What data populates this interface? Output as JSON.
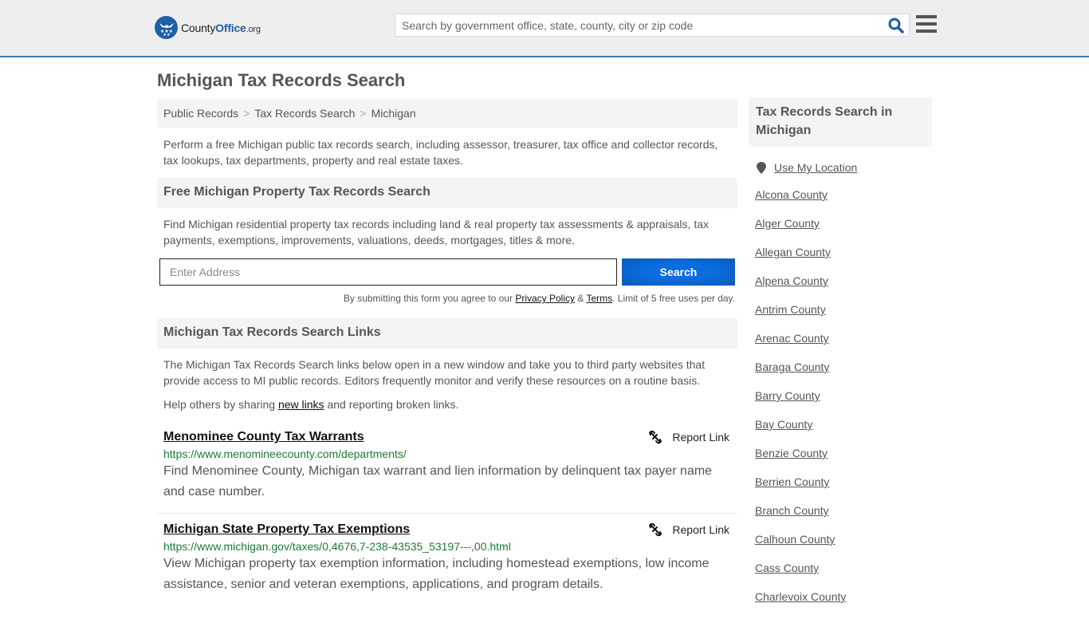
{
  "header": {
    "logo": {
      "name_part1": "County",
      "name_part2": "Office",
      "tld": ".org"
    },
    "search": {
      "placeholder": "Search by government office, state, county, city or zip code",
      "value": ""
    }
  },
  "page_title": "Michigan Tax Records Search",
  "breadcrumb": [
    {
      "label": "Public Records"
    },
    {
      "label": "Tax Records Search"
    },
    {
      "label": "Michigan"
    }
  ],
  "breadcrumb_separator": ">",
  "intro": "Perform a free Michigan public tax records search, including assessor, treasurer, tax office and collector records, tax lookups, tax departments, property and real estate taxes.",
  "property_search": {
    "heading": "Free Michigan Property Tax Records Search",
    "description": "Find Michigan residential property tax records including land & real property tax assessments & appraisals, tax payments, exemptions, improvements, valuations, deeds, mortgages, titles & more.",
    "input_placeholder": "Enter Address",
    "input_value": "",
    "button_label": "Search",
    "disclaimer_prefix": "By submitting this form you agree to our ",
    "privacy_label": "Privacy Policy",
    "amp": " & ",
    "terms_label": "Terms",
    "disclaimer_suffix": ". Limit of 5 free uses per day."
  },
  "links_section": {
    "heading": "Michigan Tax Records Search Links",
    "description": "The Michigan Tax Records Search links below open in a new window and take you to third party websites that provide access to MI public records. Editors frequently monitor and verify these resources on a routine basis.",
    "share_prefix": "Help others by sharing ",
    "share_link": "new links",
    "share_suffix": " and reporting broken links.",
    "report_label": "Report Link",
    "items": [
      {
        "title": "Menominee County Tax Warrants",
        "url": "https://www.menomineecounty.com/departments/",
        "description": "Find Menominee County, Michigan tax warrant and lien information by delinquent tax payer name and case number."
      },
      {
        "title": "Michigan State Property Tax Exemptions",
        "url": "https://www.michigan.gov/taxes/0,4676,7-238-43535_53197---,00.html",
        "description": "View Michigan property tax exemption information, including homestead exemptions, low income assistance, senior and veteran exemptions, applications, and program details."
      }
    ]
  },
  "sidebar": {
    "heading": "Tax Records Search in Michigan",
    "use_location": "Use My Location",
    "counties": [
      "Alcona County",
      "Alger County",
      "Allegan County",
      "Alpena County",
      "Antrim County",
      "Arenac County",
      "Baraga County",
      "Barry County",
      "Bay County",
      "Benzie County",
      "Berrien County",
      "Branch County",
      "Calhoun County",
      "Cass County",
      "Charlevoix County"
    ]
  }
}
